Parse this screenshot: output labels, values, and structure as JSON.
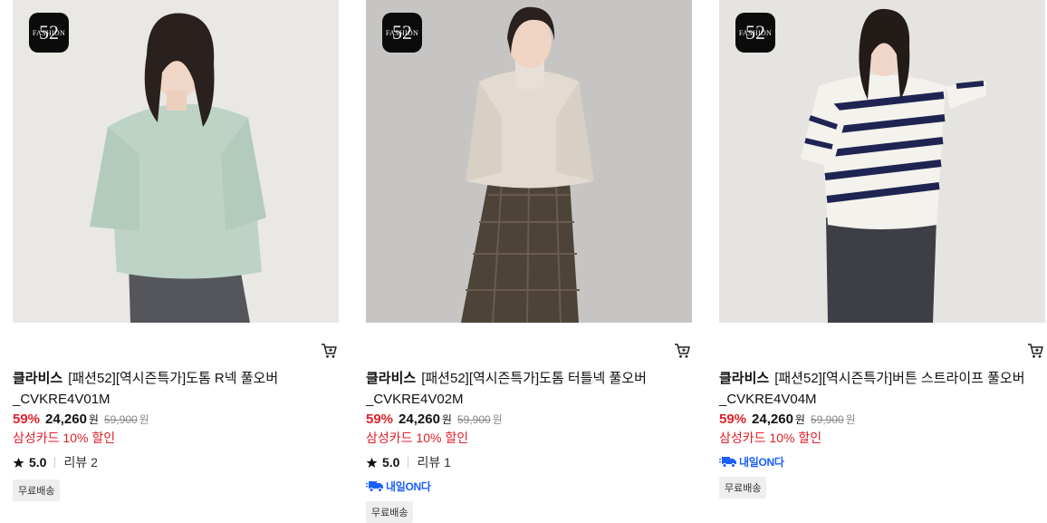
{
  "products": [
    {
      "logo_text": "FASHION",
      "logo_number": "52",
      "brand": "클라비스",
      "name": "[패션52][역시즌특가]도톰 R넥 풀오버",
      "name_line2": "_CVKRE4V01M",
      "discount_rate": "59%",
      "price": "24,260",
      "currency": "원",
      "original_price": "59,900",
      "original_currency": "원",
      "card_discount": "삼성카드 10% 할인",
      "rating": "5.0",
      "reviews": "리뷰 2",
      "delivery_badge": "",
      "free_shipping": "무료배송",
      "sweater_color": "#bcd3c6"
    },
    {
      "logo_text": "FASHION",
      "logo_number": "52",
      "brand": "클라비스",
      "name": "[패션52][역시즌특가]도톰 터틀넥 풀오버",
      "name_line2": "_CVKRE4V02M",
      "discount_rate": "59%",
      "price": "24,260",
      "currency": "원",
      "original_price": "59,900",
      "original_currency": "원",
      "card_discount": "삼성카드 10% 할인",
      "rating": "5.0",
      "reviews": "리뷰 1",
      "delivery_badge": "내일ON다",
      "free_shipping": "무료배송",
      "sweater_color": "#e3dbd1"
    },
    {
      "logo_text": "FASHION",
      "logo_number": "52",
      "brand": "클라비스",
      "name": "[패션52][역시즌특가]버튼 스트라이프 풀오버",
      "name_line2": "_CVKRE4V04M",
      "discount_rate": "59%",
      "price": "24,260",
      "currency": "원",
      "original_price": "59,900",
      "original_currency": "원",
      "card_discount": "삼성카드 10% 할인",
      "rating": "",
      "reviews": "",
      "delivery_badge": "내일ON다",
      "free_shipping": "무료배송",
      "sweater_color": "#f4f2ec"
    }
  ],
  "icons": {
    "cart": "cart-icon",
    "star": "star-icon",
    "truck": "delivery-truck-icon"
  },
  "colors": {
    "discount": "#e0212a",
    "delivery": "#1a5fff"
  }
}
